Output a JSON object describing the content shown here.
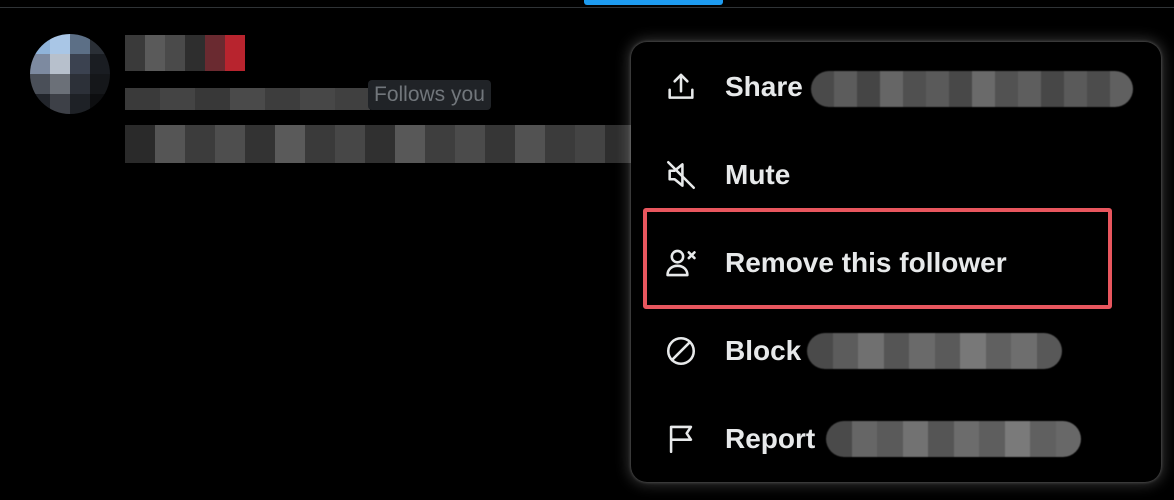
{
  "follower": {
    "badge": "Follows you"
  },
  "menu": {
    "items": [
      {
        "label": "Share",
        "icon": "share-icon"
      },
      {
        "label": "Mute",
        "icon": "mute-icon"
      },
      {
        "label": "Remove this follower",
        "icon": "remove-follower-icon"
      },
      {
        "label": "Block",
        "icon": "block-icon"
      },
      {
        "label": "Report",
        "icon": "flag-icon"
      }
    ]
  },
  "colors": {
    "background": "#000000",
    "text": "#e7e9ea",
    "muted": "#71767b",
    "accent": "#1d9bf0",
    "highlight": "#e8565e"
  }
}
